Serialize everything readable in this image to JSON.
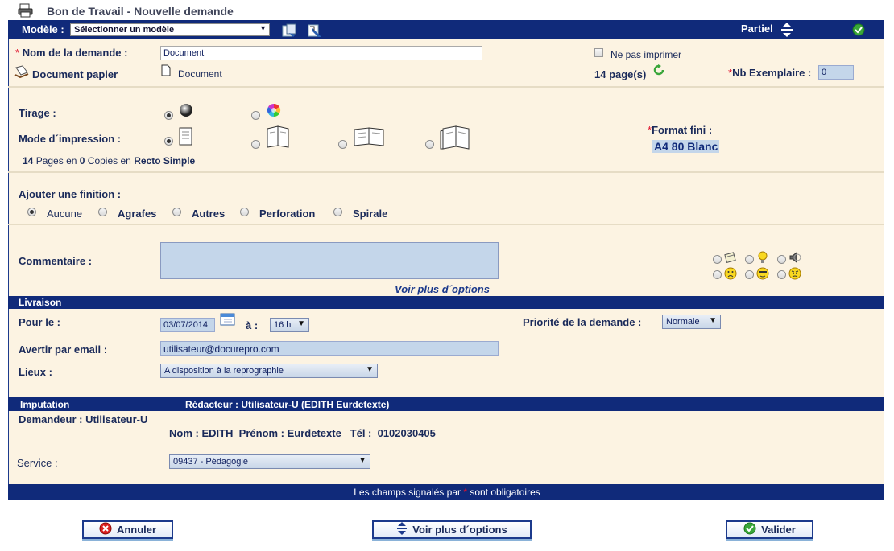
{
  "title": "Bon de Travail - Nouvelle demande",
  "header": {
    "modele_label": "Modèle :",
    "modele_select": "Sélectionner un modèle",
    "partiel_label": "Partiel"
  },
  "demande": {
    "nom_star": "*",
    "nom_label": "Nom de la demande :",
    "nom_value": "Document",
    "document_papier": "Document papier",
    "document_link": "Document",
    "ne_pas_imprimer": "Ne pas imprimer",
    "pages": "14 page(s)",
    "nb_star": "*",
    "nb_label": "Nb Exemplaire :",
    "nb_value": "0"
  },
  "tirage": {
    "tirage_label": "Tirage :",
    "mode_label": "Mode d´impression :",
    "format_star": "*",
    "format_label": "Format fini :",
    "format_value": "A4 80 Blanc",
    "summary": {
      "pages": "14",
      "pages_text": "Pages en",
      "copies": "0",
      "copies_text": "Copies en",
      "recto": "Recto Simple"
    }
  },
  "finition": {
    "label": "Ajouter une finition :",
    "options": [
      "Aucune",
      "Agrafes",
      "Autres",
      "Perforation",
      "Spirale"
    ]
  },
  "commentaire": {
    "label": "Commentaire :",
    "voir_plus": "Voir plus d´options"
  },
  "livraison": {
    "header": "Livraison",
    "pour_le_label": "Pour le :",
    "date": "03/07/2014",
    "a_label": "à :",
    "heure": "16 h",
    "priorite_label": "Priorité de la demande :",
    "priorite_value": "Normale",
    "email_label": "Avertir par email :",
    "email_value": "utilisateur@docurepro.com",
    "lieux_label": "Lieux :",
    "lieux_value": "A disposition à la reprographie"
  },
  "imputation": {
    "header": "Imputation",
    "redacteur": "Rédacteur : Utilisateur-U (EDITH Eurdetexte)",
    "demandeur": "Demandeur : Utilisateur-U",
    "details": "Nom : EDITH  Prénom : Eurdetexte   Tél :  0102030405",
    "service_label": "Service :",
    "service_value": "09437 - Pédagogie"
  },
  "footer": {
    "text_before": "Les champs signalés par",
    "star": "*",
    "text_after": "sont obligatoires"
  },
  "buttons": {
    "annuler": "Annuler",
    "voir_plus": "Voir plus d´options",
    "valider": "Valider"
  },
  "colors": {
    "navy": "#102a7a",
    "cream": "#fcf3e2",
    "required": "#e0102a",
    "green": "#3aa63a"
  }
}
